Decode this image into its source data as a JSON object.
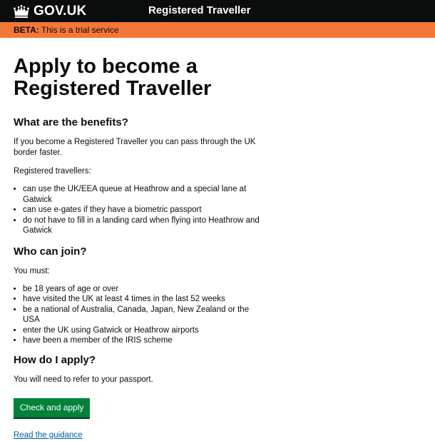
{
  "header": {
    "logo_text": "GOV.UK",
    "logo_icon": "crown-icon",
    "service_name": "Registered Traveller"
  },
  "beta_banner": {
    "tag": "BETA:",
    "text": "This is a trial service",
    "color": "#f47738"
  },
  "main": {
    "title": "Apply to become a Registered Traveller",
    "sections": [
      {
        "heading": "What are the benefits?",
        "paragraphs": [
          "If you become a Registered Traveller you can pass through the UK border faster.",
          "Registered travellers:"
        ],
        "bullets": [
          "can use the UK/EEA queue at Heathrow and a special lane at Gatwick",
          "can use e-gates if they have a biometric passport",
          "do not have to fill in a landing card when flying into Heathrow and Gatwick"
        ]
      },
      {
        "heading": "Who can join?",
        "paragraphs": [
          "You must:"
        ],
        "bullets": [
          "be 18 years of age or over",
          "have visited the UK at least 4 times in the last 52 weeks",
          "be a national of Australia, Canada, Japan, New Zealand or the USA",
          "enter the UK using Gatwick or Heathrow airports",
          "have been a member of the IRIS scheme"
        ]
      },
      {
        "heading": "How do I apply?",
        "paragraphs": [
          "You will need to refer to your passport."
        ]
      }
    ],
    "start_button": "Check and apply",
    "guidance_link": "Read the guidance",
    "button_color": "#00823b",
    "link_color": "#005ea5"
  }
}
